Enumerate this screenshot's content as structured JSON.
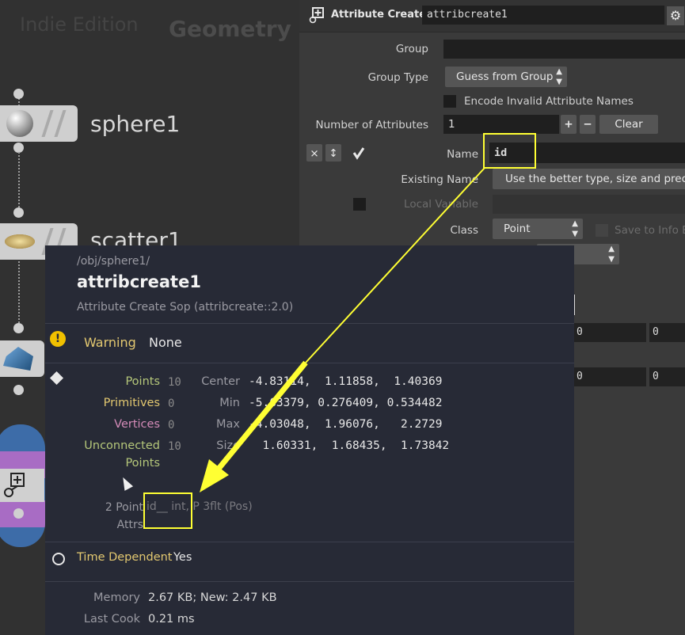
{
  "network": {
    "edition_label": "Indie Edition",
    "context_label": "Geometry",
    "nodes": [
      {
        "name": "sphere1"
      },
      {
        "name": "scatter1"
      }
    ]
  },
  "params": {
    "node_type": "Attribute Create",
    "node_name": "attribcreate1",
    "gear_glyph": "⚙",
    "group_label": "Group",
    "group_value": "",
    "group_type_label": "Group Type",
    "group_type_value": "Guess from Group",
    "encode_label": "Encode Invalid Attribute Names",
    "num_attrs_label": "Number of Attributes",
    "num_attrs_value": "1",
    "plus_label": "+",
    "minus_label": "−",
    "clear_label": "Clear",
    "remove_label": "×",
    "move_label": "↕",
    "name_label": "Name",
    "name_value": "id",
    "existing_name_label": "Existing Name",
    "existing_name_value": "Use the better type, size and precis",
    "local_variable_label": "Local Variable",
    "class_label": "Class",
    "class_value": "Point",
    "save_info_label": "Save to Info B",
    "row_values_1": [
      "0",
      "0"
    ],
    "row_values_2": [
      "0",
      "0"
    ]
  },
  "info": {
    "path": "/obj/sphere1/",
    "title": "attribcreate1",
    "subtitle": "Attribute Create Sop (attribcreate::2.0)",
    "warning_label": "Warning",
    "warning_value": "None",
    "stats": [
      {
        "label": "Points",
        "value": "10",
        "color": "#b5c77a"
      },
      {
        "label": "Primitives",
        "value": "0",
        "color": "#e3c870"
      },
      {
        "label": "Vertices",
        "value": "0",
        "color": "#d48bb8"
      },
      {
        "label": "Unconnected",
        "label2": "Points",
        "value": "10",
        "color": "#b5c77a"
      }
    ],
    "geo": [
      {
        "label": "Center",
        "value": "-4.83114,  1.11858,  1.40369"
      },
      {
        "label": "Min",
        "value": "-5.63379, 0.276409, 0.534482"
      },
      {
        "label": "Max",
        "value": "-4.03048,  1.96076,   2.2729"
      },
      {
        "label": "Size",
        "value": "  1.60331,  1.68435,  1.73842"
      }
    ],
    "attrs_label_1": "2 Point",
    "attrs_label_2": "Attrs",
    "attrs_value": "id__ int, P 3flt (Pos)",
    "time_dependent_label": "Time Dependent",
    "time_dependent_value": "Yes",
    "memory_label": "Memory",
    "memory_value": "2.67 KB; New: 2.47 KB",
    "last_cook_label": "Last Cook",
    "last_cook_value": "0.21 ms"
  },
  "colors": {
    "highlight": "#ffff33",
    "warning_yellow": "#f0c000"
  }
}
